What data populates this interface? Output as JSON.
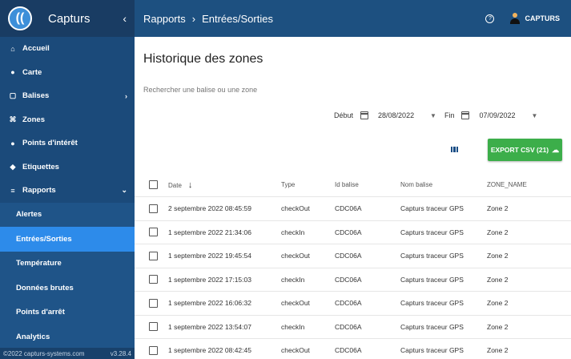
{
  "app": {
    "title": "Capturs",
    "logo_glyph": "((",
    "collapse_glyph": "‹"
  },
  "sidebar": {
    "items": [
      {
        "label": "Accueil",
        "icon": "home-icon",
        "glyph": "⌂"
      },
      {
        "label": "Carte",
        "icon": "map-pin-icon",
        "glyph": "●"
      },
      {
        "label": "Balises",
        "icon": "tag-icon",
        "glyph": "▢",
        "chevron": "›"
      },
      {
        "label": "Zones",
        "icon": "zones-icon",
        "glyph": "⌘"
      },
      {
        "label": "Points d'intérêt",
        "icon": "poi-pin-icon",
        "glyph": "●"
      },
      {
        "label": "Etiquettes",
        "icon": "label-icon",
        "glyph": "◆"
      },
      {
        "label": "Rapports",
        "icon": "list-icon",
        "glyph": "≡",
        "chevron": "⌄"
      }
    ],
    "sub_items": [
      {
        "label": "Alertes"
      },
      {
        "label": "Entrées/Sorties",
        "active": true
      },
      {
        "label": "Température"
      },
      {
        "label": "Données brutes"
      },
      {
        "label": "Points d'arrêt"
      },
      {
        "label": "Analytics"
      }
    ],
    "footer": {
      "copyright": "©2022 capturs-systems.com",
      "version": "v3.28.4"
    }
  },
  "topbar": {
    "breadcrumb_parent": "Rapports",
    "breadcrumb_sep": "›",
    "breadcrumb_current": "Entrées/Sorties",
    "username": "CAPTURS"
  },
  "main": {
    "title": "Historique des zones",
    "search_placeholder": "Rechercher une balise ou une zone",
    "start_label": "Début",
    "start_date": "28/08/2022",
    "end_label": "Fin",
    "end_date": "07/09/2022",
    "export_label": "EXPORT CSV (21)"
  },
  "table": {
    "headers": {
      "date": "Date",
      "type": "Type",
      "id": "Id balise",
      "nom": "Nom balise",
      "zone": "ZONE_NAME"
    },
    "rows": [
      {
        "date": "2 septembre 2022 08:45:59",
        "type": "checkOut",
        "id": "CDC06A",
        "nom": "Capturs traceur GPS",
        "zone": "Zone 2"
      },
      {
        "date": "1 septembre 2022 21:34:06",
        "type": "checkIn",
        "id": "CDC06A",
        "nom": "Capturs traceur GPS",
        "zone": "Zone 2"
      },
      {
        "date": "1 septembre 2022 19:45:54",
        "type": "checkOut",
        "id": "CDC06A",
        "nom": "Capturs traceur GPS",
        "zone": "Zone 2"
      },
      {
        "date": "1 septembre 2022 17:15:03",
        "type": "checkIn",
        "id": "CDC06A",
        "nom": "Capturs traceur GPS",
        "zone": "Zone 2"
      },
      {
        "date": "1 septembre 2022 16:06:32",
        "type": "checkOut",
        "id": "CDC06A",
        "nom": "Capturs traceur GPS",
        "zone": "Zone 2"
      },
      {
        "date": "1 septembre 2022 13:54:07",
        "type": "checkIn",
        "id": "CDC06A",
        "nom": "Capturs traceur GPS",
        "zone": "Zone 2"
      },
      {
        "date": "1 septembre 2022 08:42:45",
        "type": "checkOut",
        "id": "CDC06A",
        "nom": "Capturs traceur GPS",
        "zone": "Zone 2"
      }
    ]
  },
  "colors": {
    "sidebar": "#1b4a7a",
    "topbar": "#1d5080",
    "active": "#2d8bea",
    "export": "#3cae4a"
  }
}
